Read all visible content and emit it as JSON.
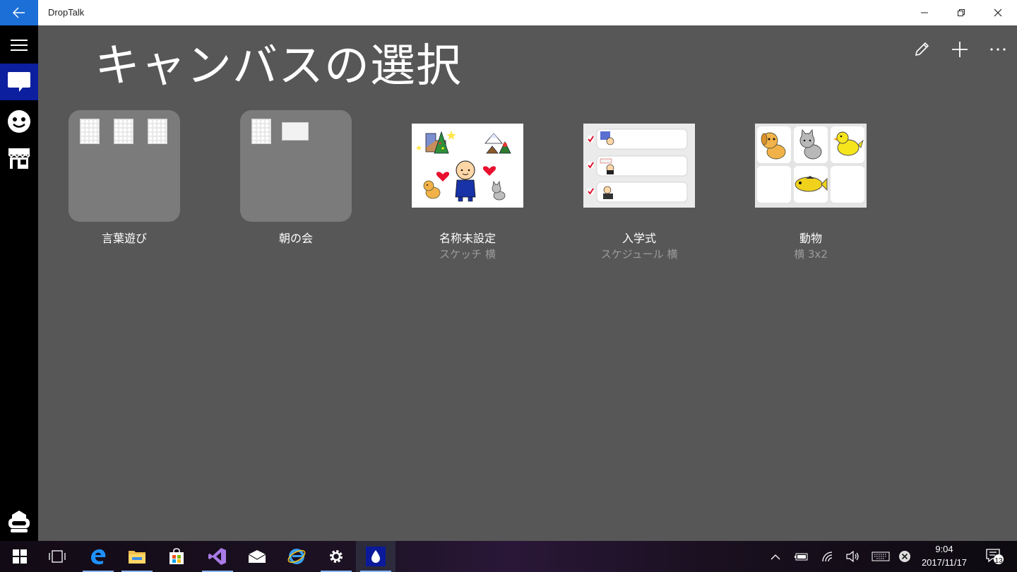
{
  "app": {
    "title": "DropTalk"
  },
  "page": {
    "title": "キャンバスの選択"
  },
  "tiles": [
    {
      "label": "言葉遊び",
      "sub": ""
    },
    {
      "label": "朝の会",
      "sub": ""
    },
    {
      "label": "名称未設定",
      "sub": "スケッチ 横"
    },
    {
      "label": "入学式",
      "sub": "スケジュール 横"
    },
    {
      "label": "動物",
      "sub": "横 3x2"
    }
  ],
  "taskbar": {
    "time": "9:04",
    "date": "2017/11/17",
    "notification_count": "13"
  },
  "colors": {
    "accent": "#1b6fd6",
    "sidebar_active": "#0c1f9e",
    "background": "#575757",
    "folder": "#7b7b7b"
  }
}
